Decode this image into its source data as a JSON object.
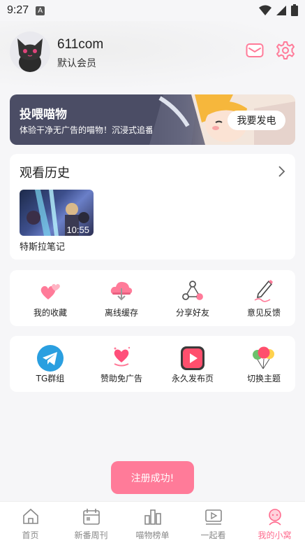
{
  "status_bar": {
    "time": "9:27",
    "notification_glyph": "A"
  },
  "profile": {
    "username": "611com",
    "member_level": "默认会员"
  },
  "banner": {
    "title": "投喂喵物",
    "subtitle": "体验干净无广告的喵物！沉浸式追番",
    "button_label": "我要发电"
  },
  "history": {
    "title": "观看历史",
    "items": [
      {
        "title": "特斯拉笔记",
        "duration": "10:55"
      }
    ]
  },
  "actions_row1": [
    {
      "label": "我的收藏",
      "icon": "hearts-icon"
    },
    {
      "label": "离线缓存",
      "icon": "cloud-download-icon"
    },
    {
      "label": "分享好友",
      "icon": "share-icon"
    },
    {
      "label": "意见反馈",
      "icon": "pen-icon"
    }
  ],
  "actions_row2": [
    {
      "label": "TG群组",
      "icon": "telegram-icon"
    },
    {
      "label": "赞助免广告",
      "icon": "heart-gift-icon"
    },
    {
      "label": "永久发布页",
      "icon": "play-icon"
    },
    {
      "label": "切换主题",
      "icon": "balloons-icon"
    }
  ],
  "toast": {
    "message": "注册成功!"
  },
  "bottom_nav": [
    {
      "label": "首页",
      "icon": "home-icon",
      "active": false
    },
    {
      "label": "新番周刊",
      "icon": "calendar-icon",
      "active": false
    },
    {
      "label": "喵物榜单",
      "icon": "ranking-icon",
      "active": false
    },
    {
      "label": "一起看",
      "icon": "video-icon",
      "active": false
    },
    {
      "label": "我的小窝",
      "icon": "profile-icon",
      "active": true
    }
  ],
  "colors": {
    "accent": "#ff6b8e",
    "banner_bg": "#4b4d65",
    "toast_bg": "#ff7b99",
    "telegram": "#2a9fe0"
  }
}
